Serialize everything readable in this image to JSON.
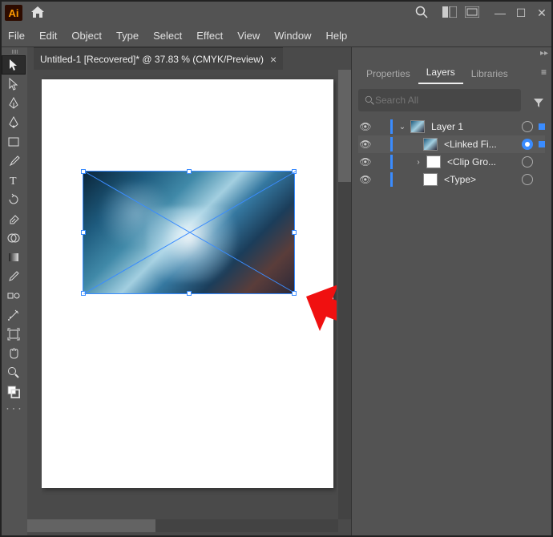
{
  "app": {
    "logo_text": "Ai"
  },
  "menu": [
    "File",
    "Edit",
    "Object",
    "Type",
    "Select",
    "Effect",
    "View",
    "Window",
    "Help"
  ],
  "document": {
    "tab_title": "Untitled-1 [Recovered]* @ 37.83 % (CMYK/Preview)"
  },
  "panel": {
    "tabs": {
      "properties": "Properties",
      "layers": "Layers",
      "libraries": "Libraries"
    },
    "search_placeholder": "Search All"
  },
  "layers": [
    {
      "name": "Layer 1"
    },
    {
      "name": "<Linked Fi..."
    },
    {
      "name": "<Clip Gro..."
    },
    {
      "name": "<Type>"
    }
  ]
}
